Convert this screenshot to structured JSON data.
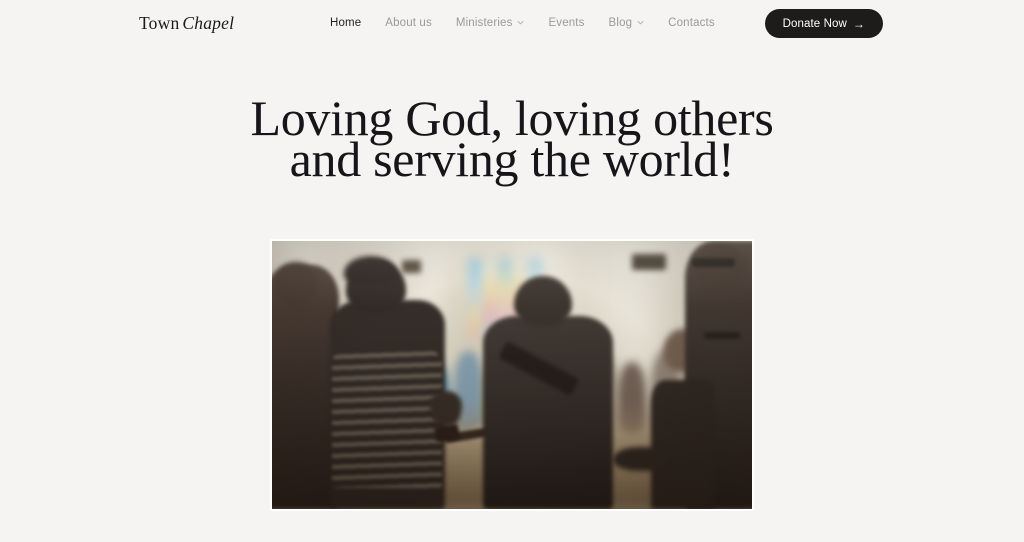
{
  "site": {
    "background_color": "#f5f4f2",
    "logo": {
      "first_word": "Town",
      "second_word": "Chapel"
    }
  },
  "header": {
    "nav": [
      {
        "label": "Home",
        "active": true,
        "has_dropdown": false
      },
      {
        "label": "About us",
        "active": false,
        "has_dropdown": false
      },
      {
        "label": "Ministeries",
        "active": false,
        "has_dropdown": true
      },
      {
        "label": "Events",
        "active": false,
        "has_dropdown": false
      },
      {
        "label": "Blog",
        "active": false,
        "has_dropdown": true
      },
      {
        "label": "Contacts",
        "active": false,
        "has_dropdown": false
      }
    ],
    "cta": {
      "label": "Donate Now",
      "arrow": "→",
      "background_color": "#1e1c1b",
      "text_color": "#ffffff"
    },
    "active_link_color": "#222222",
    "link_color": "#9a9a98"
  },
  "hero": {
    "headline_line_1": "Loving God, loving others",
    "headline_line_2": "and serving the world!",
    "headline_color": "#16161a",
    "image": {
      "alt": "Church congregation worshipping indoors, silhouetted guitarist and people with raised hands in front of a stained glass window"
    }
  }
}
